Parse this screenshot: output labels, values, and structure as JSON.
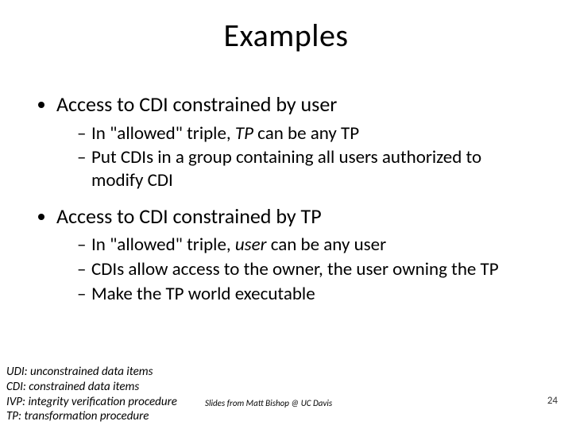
{
  "title": "Examples",
  "bullets": [
    {
      "text": "Access to CDI constrained by user",
      "sub": [
        {
          "pre": "In \"allowed\" triple, ",
          "em": "TP",
          "post": " can be any TP"
        },
        {
          "pre": "Put CDIs in a group containing all users authorized to modify CDI",
          "em": "",
          "post": ""
        }
      ]
    },
    {
      "text": "Access to CDI constrained by TP",
      "sub": [
        {
          "pre": "In \"allowed\" triple, ",
          "em": "user",
          "post": " can be any user"
        },
        {
          "pre": "CDIs allow access to the owner, the user owning the TP",
          "em": "",
          "post": ""
        },
        {
          "pre": "Make the TP world executable",
          "em": "",
          "post": ""
        }
      ]
    }
  ],
  "definitions": {
    "udi": "UDI: unconstrained data items",
    "cdi": "CDI: constrained data items",
    "ivp": "IVP: integrity verification procedure",
    "tp": "TP: transformation procedure"
  },
  "credit": "Slides from Matt Bishop @ UC Davis",
  "page_number": "24"
}
